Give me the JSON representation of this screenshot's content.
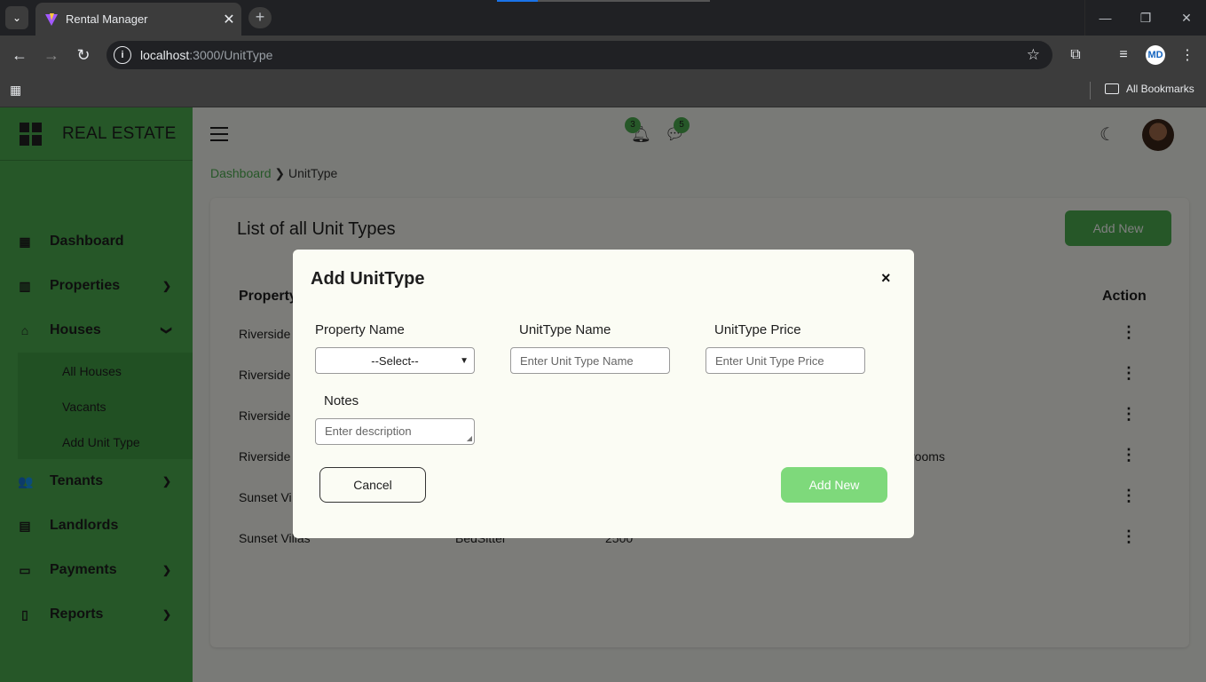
{
  "browser": {
    "tab_title": "Rental Manager",
    "url_host": "localhost",
    "url_path": ":3000/UnitType",
    "bookmarks_label": "All Bookmarks",
    "profile_initials": "MD"
  },
  "sidebar": {
    "brand": "REAL ESTATE",
    "items": [
      {
        "label": "Dashboard",
        "icon": "dashboard-icon"
      },
      {
        "label": "Properties",
        "icon": "building-icon"
      },
      {
        "label": "Houses",
        "icon": "home-icon"
      },
      {
        "label": "Tenants",
        "icon": "users-icon"
      },
      {
        "label": "Landlords",
        "icon": "landlord-icon"
      },
      {
        "label": "Payments",
        "icon": "payment-icon"
      },
      {
        "label": "Reports",
        "icon": "report-icon"
      }
    ],
    "submenu": [
      "All Houses",
      "Vacants",
      "Add Unit Type"
    ]
  },
  "header": {
    "notifications": "3",
    "messages": "5"
  },
  "breadcrumb": {
    "root": "Dashboard",
    "current": "UnitType"
  },
  "card": {
    "title": "List of all Unit Types",
    "add_button": "Add New",
    "columns": {
      "property": "Property",
      "action": "Action"
    },
    "rows": [
      {
        "property": "Riverside",
        "type": "",
        "price": "",
        "notes": ""
      },
      {
        "property": "Riverside",
        "type": "",
        "price": "",
        "notes": ""
      },
      {
        "property": "Riverside",
        "type": "",
        "price": "",
        "notes": ""
      },
      {
        "property": "Riverside",
        "type": "",
        "price": "",
        "notes": "rooms"
      },
      {
        "property": "Sunset Vi",
        "type": "",
        "price": "",
        "notes": ""
      },
      {
        "property": "Sunset Villas",
        "type": "BedSitter",
        "price": "2500",
        "notes": ""
      }
    ]
  },
  "modal": {
    "title": "Add UnitType",
    "close": "×",
    "property_label": "Property Name",
    "property_selected": "--Select--",
    "name_label": "UnitType Name",
    "name_placeholder": "Enter Unit Type Name",
    "price_label": "UnitType Price",
    "price_placeholder": "Enter Unit Type Price",
    "notes_label": "Notes",
    "notes_placeholder": "Enter description",
    "cancel": "Cancel",
    "submit": "Add New"
  },
  "colors": {
    "accent": "#4caf50",
    "submit_button": "#7ed97b"
  }
}
